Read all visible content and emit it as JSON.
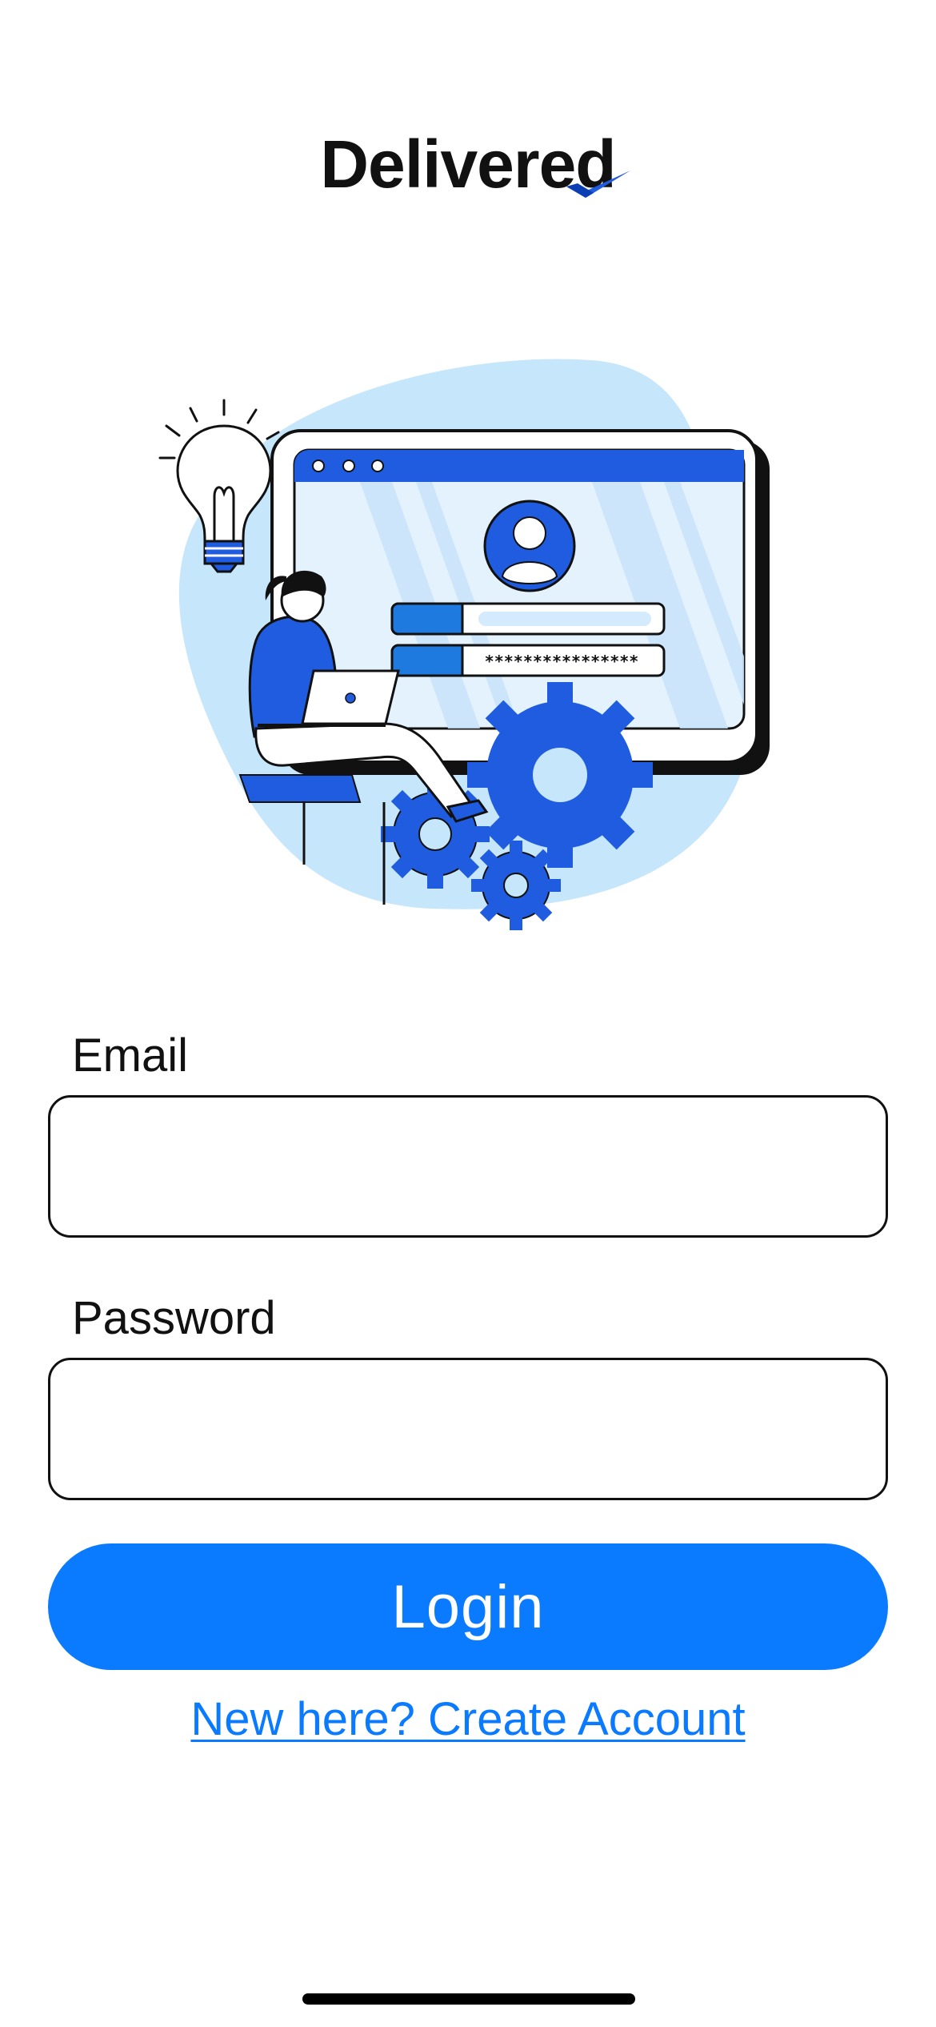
{
  "app": {
    "logo_text": "Delivered",
    "brand_color": "#0a7aff",
    "accent_color": "#1f5ce0"
  },
  "illustration": {
    "mock_password_mask": "****************",
    "icons": [
      "lightbulb-icon",
      "user-avatar-icon",
      "gear-icon"
    ]
  },
  "form": {
    "email_label": "Email",
    "email_value": "",
    "password_label": "Password",
    "password_value": ""
  },
  "actions": {
    "login_label": "Login",
    "create_account_label": "New here? Create Account"
  }
}
